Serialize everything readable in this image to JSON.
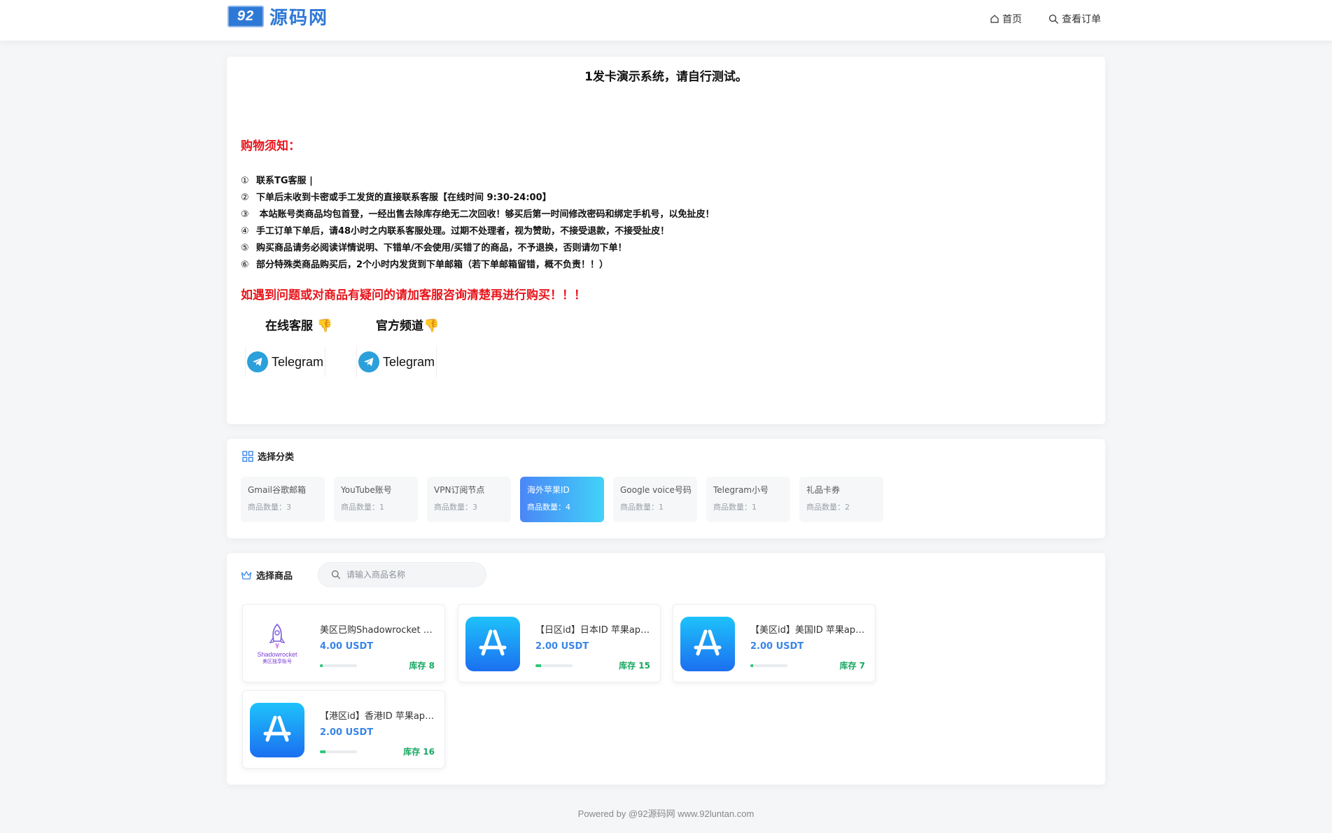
{
  "header": {
    "logo_badge": "92",
    "logo_text": "源码网",
    "nav": [
      {
        "label": "首页",
        "icon": "home-icon"
      },
      {
        "label": "查看订单",
        "icon": "search-icon"
      }
    ]
  },
  "notice": {
    "title": "1发卡演示系统，请自行测试。",
    "heading": "购物须知：",
    "rules": [
      {
        "num": "①",
        "text": "联系TG客服 |"
      },
      {
        "num": "②",
        "text": "下单后未收到卡密或手工发货的直接联系客服【在线时间 9:30-24:00】"
      },
      {
        "num": "③",
        "text": " 本站账号类商品均包首登，一经出售去除库存绝无二次回收！够买后第一时间修改密码和绑定手机号，以免扯皮！"
      },
      {
        "num": "④",
        "text": "手工订单下单后，请48小时之内联系客服处理。过期不处理者，视为赞助，不接受退款，不接受扯皮！"
      },
      {
        "num": "⑤",
        "text": "购买商品请务必阅读详情说明、下错单/不会使用/买错了的商品，不予退换，否则请勿下单！"
      },
      {
        "num": "⑥",
        "text": "部分特殊类商品购买后，2个小时内发货到下单邮箱（若下单邮箱留错，概不负责！！）"
      }
    ],
    "warning": "如遇到问题或对商品有疑问的请加客服咨询清楚再进行购买！！！",
    "contacts": [
      {
        "label": "在线客服",
        "button": "Telegram"
      },
      {
        "label": "官方频道",
        "button": "Telegram"
      }
    ]
  },
  "categories": {
    "title": "选择分类",
    "items": [
      {
        "name": "Gmail谷歌邮箱",
        "count": "商品数量：3"
      },
      {
        "name": "YouTube账号",
        "count": "商品数量：1"
      },
      {
        "name": "VPN订阅节点",
        "count": "商品数量：3"
      },
      {
        "name": "海外苹果ID",
        "count": "商品数量：4",
        "active": true
      },
      {
        "name": "Google voice号码",
        "count": "商品数量：1"
      },
      {
        "name": "Telegram小号",
        "count": "商品数量：1"
      },
      {
        "name": "礼品卡券",
        "count": "商品数量：2"
      }
    ]
  },
  "products": {
    "title": "选择商品",
    "search_placeholder": "请输入商品名称",
    "items": [
      {
        "name": "美区已购Shadowrocket 小火箭账号",
        "price": "4.00 USDT",
        "stock": "库存 8",
        "stock_level": 0.08,
        "image": "shadowrocket",
        "image_text": "Shadowrocket",
        "image_subtext": "美区独享账号"
      },
      {
        "name": "【日区id】日本ID 苹果apple id",
        "price": "2.00 USDT",
        "stock": "库存 15",
        "stock_level": 0.15,
        "image": "appstore"
      },
      {
        "name": "【美区id】美国ID 苹果apple id",
        "price": "2.00 USDT",
        "stock": "库存 7",
        "stock_level": 0.07,
        "image": "appstore"
      },
      {
        "name": "【港区id】香港ID 苹果apple id",
        "price": "2.00 USDT",
        "stock": "库存 16",
        "stock_level": 0.16,
        "image": "appstore"
      }
    ]
  },
  "footer": "Powered by @92源码网 www.92luntan.com"
}
